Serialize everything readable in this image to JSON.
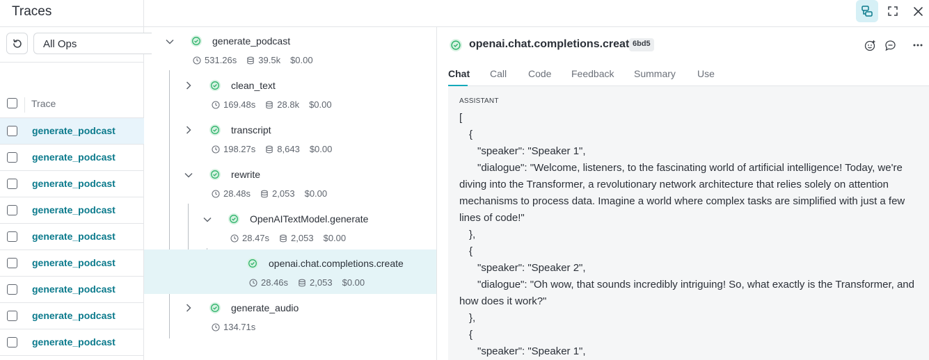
{
  "left_panel": {
    "title": "Traces",
    "ops_filter": "All Ops",
    "column_header": "Trace",
    "rows": [
      {
        "label": "generate_podcast",
        "selected": true
      },
      {
        "label": "generate_podcast",
        "selected": false
      },
      {
        "label": "generate_podcast",
        "selected": false
      },
      {
        "label": "generate_podcast",
        "selected": false
      },
      {
        "label": "generate_podcast",
        "selected": false
      },
      {
        "label": "generate_podcast",
        "selected": false
      },
      {
        "label": "generate_podcast",
        "selected": false
      },
      {
        "label": "generate_podcast",
        "selected": false
      },
      {
        "label": "generate_podcast",
        "selected": false
      }
    ]
  },
  "toolbar": {
    "icons": [
      "split-view-icon",
      "fullscreen-icon",
      "close-icon"
    ]
  },
  "tree": {
    "nodes": [
      {
        "name": "generate_podcast",
        "duration": "531.26s",
        "tokens": "39.5k",
        "cost": "$0.00",
        "chevron": "down"
      },
      {
        "name": "clean_text",
        "duration": "169.48s",
        "tokens": "28.8k",
        "cost": "$0.00",
        "chevron": "right"
      },
      {
        "name": "transcript",
        "duration": "198.27s",
        "tokens": "8,643",
        "cost": "$0.00",
        "chevron": "right"
      },
      {
        "name": "rewrite",
        "duration": "28.48s",
        "tokens": "2,053",
        "cost": "$0.00",
        "chevron": "down"
      },
      {
        "name": "OpenAITextModel.generate",
        "duration": "28.47s",
        "tokens": "2,053",
        "cost": "$0.00",
        "chevron": "down"
      },
      {
        "name": "openai.chat.completions.create",
        "duration": "28.46s",
        "tokens": "2,053",
        "cost": "$0.00",
        "chevron": "none"
      },
      {
        "name": "generate_audio",
        "duration": "134.71s",
        "tokens": "",
        "cost": "",
        "chevron": "right"
      }
    ]
  },
  "detail": {
    "op_name": "openai.chat.completions.create",
    "badge": "6bd5",
    "tabs": [
      "Chat",
      "Call",
      "Code",
      "Feedback",
      "Summary",
      "Use"
    ],
    "active_tab": "Chat",
    "role": "ASSISTANT",
    "lines": [
      "[",
      "{",
      "\"speaker\": \"Speaker 1\",",
      "\"dialogue\": \"Welcome, listeners, to the fascinating world of artificial intelligence! Today, we're diving into the Transformer, a revolutionary network architecture that relies solely on attention mechanisms to process data. Imagine a world where complex tasks are simplified with just a few lines of code!\"",
      "},",
      "{",
      "\"speaker\": \"Speaker 2\",",
      "\"dialogue\": \"Oh wow, that sounds incredibly intriguing! So, what exactly is the Transformer, and how does it work?\"",
      "},",
      "{",
      "\"speaker\": \"Speaker 1\","
    ]
  },
  "colors": {
    "accent": "#13a9ba",
    "link": "#0b7a8c",
    "success": "#2fb36b",
    "selected_row": "#e8f4fb",
    "selected_node": "#e4f4f7"
  }
}
